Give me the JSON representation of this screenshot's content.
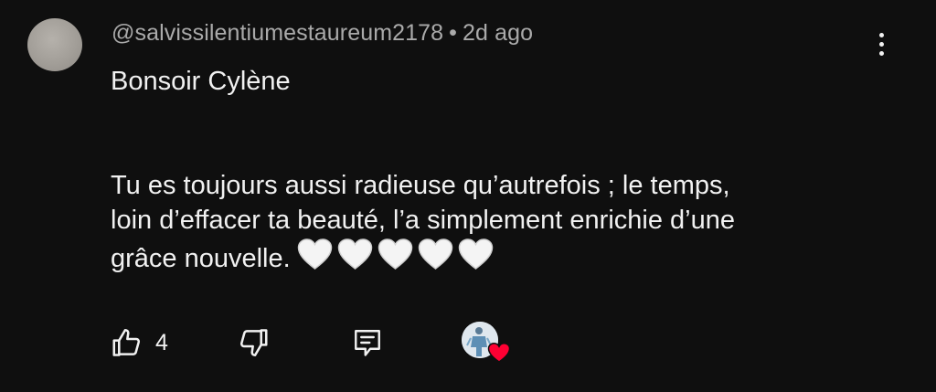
{
  "comment": {
    "author": "@salvissilentiumestaureum2178",
    "separator": "•",
    "time": "2d ago",
    "line1": "Bonsoir Cylène",
    "line2": "Tu es toujours aussi radieuse qu’autrefois ; le temps,",
    "line3": "loin d’effacer ta beauté, l’a simplement enrichie d’une",
    "line4": "grâce nouvelle.",
    "emoji": "white-heart x5"
  },
  "actions": {
    "like_count": "4",
    "like_icon": "thumbs-up-icon",
    "dislike_icon": "thumbs-down-icon",
    "reply_icon": "reply-icon",
    "creator_heart_icon": "creator-heart-icon"
  },
  "colors": {
    "background": "#0f0f0f",
    "text": "#f1f1f1",
    "meta": "#aaaaaa",
    "heart_red": "#ff0033"
  }
}
